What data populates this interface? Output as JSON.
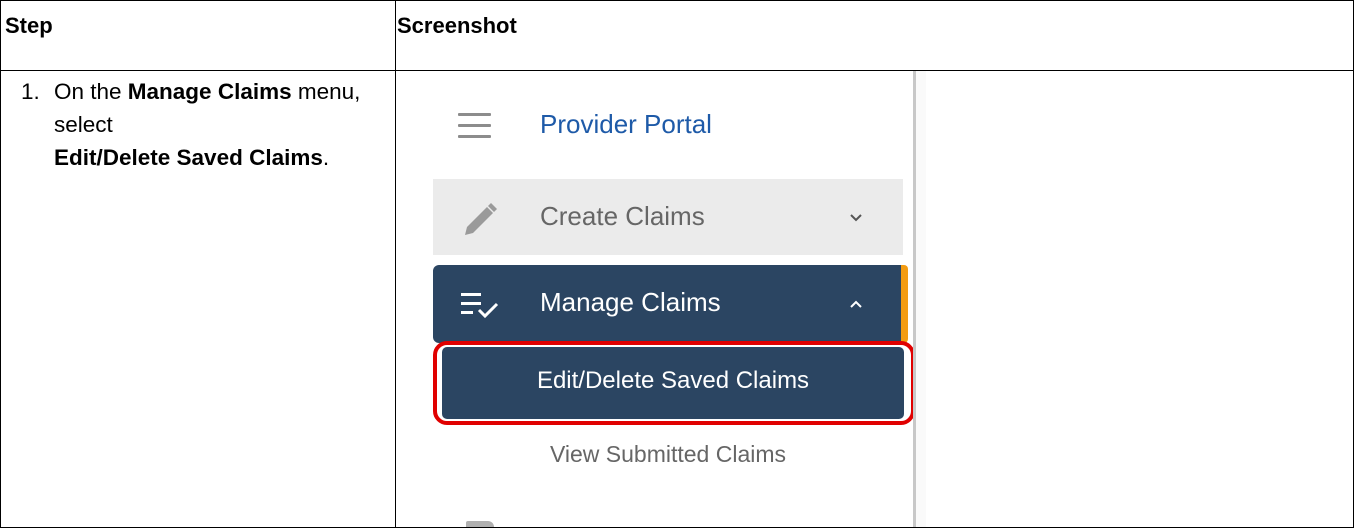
{
  "table": {
    "header": {
      "step": "Step",
      "screenshot": "Screenshot"
    },
    "rows": [
      {
        "number": "1.",
        "text_parts": [
          "On the ",
          "Manage Claims",
          " menu, select ",
          "Edit/Delete Saved Claims",
          "."
        ]
      }
    ]
  },
  "screenshot": {
    "brand": "Provider Portal",
    "menu": {
      "create_claims": "Create Claims",
      "manage_claims": "Manage Claims",
      "edit_delete_saved": "Edit/Delete Saved Claims",
      "view_submitted": "View Submitted Claims"
    },
    "colors": {
      "nav_dark": "#2b4562",
      "accent": "#f39c12",
      "highlight": "#e00000",
      "brand_text": "#1e5aa8"
    },
    "icons": {
      "menu": "hamburger-icon",
      "create": "pencil-icon",
      "manage": "list-check-icon",
      "collapse": "chevron-down-icon",
      "expand": "chevron-up-icon"
    }
  }
}
